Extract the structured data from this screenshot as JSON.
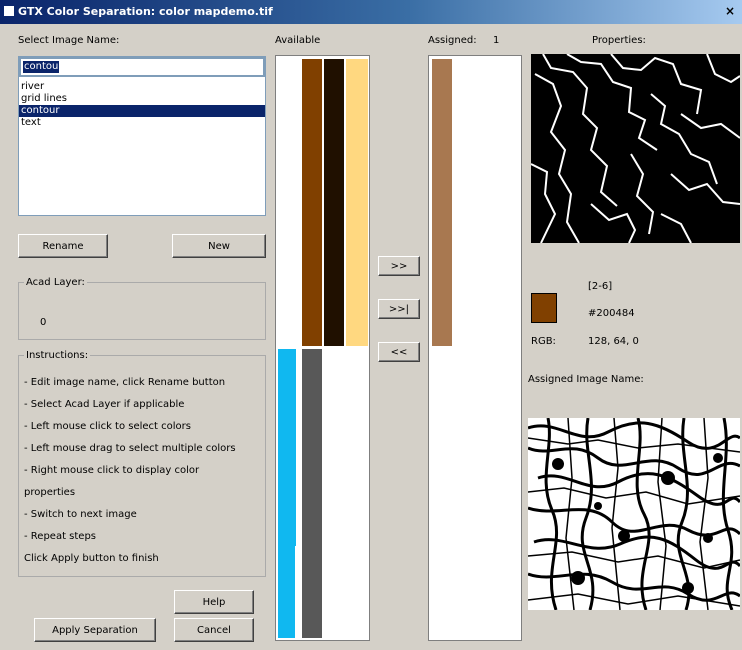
{
  "window": {
    "title": "GTX Color Separation: color mapdemo.tif",
    "close_glyph": "×"
  },
  "left": {
    "select_label": "Select Image Name:",
    "name_value": "contour",
    "list_items": [
      "river",
      "grid lines",
      "contour",
      "text"
    ],
    "selected_index": 2,
    "rename_label": "Rename",
    "new_label": "New",
    "acad_group_label": "Acad Layer:",
    "acad_value": "0",
    "instructions_label": "Instructions:",
    "instructions": [
      "- Edit image name, click Rename button",
      "- Select Acad Layer if applicable",
      "- Left mouse click to select colors",
      "- Left mouse drag to select multiple colors",
      "- Right mouse click to display color",
      "  properties",
      "- Switch to next image",
      "- Repeat steps",
      "Click Apply button to finish"
    ],
    "help_label": "Help",
    "apply_label": "Apply Separation",
    "cancel_label": "Cancel"
  },
  "available": {
    "label": "Available"
  },
  "transfer": {
    "add_label": ">>",
    "add_all_label": ">>|",
    "remove_label": "<<"
  },
  "assigned": {
    "label": "Assigned:",
    "count": "1"
  },
  "properties": {
    "label": "Properties:",
    "index": "[2-6]",
    "hex": "#200484",
    "rgb_label": "RGB:",
    "rgb_value": "128, 64, 0",
    "swatch_color": "#804000",
    "assigned_image_label": "Assigned Image Name:"
  },
  "colors": {
    "brown": "#804000",
    "dark": "#201000",
    "tan": "#ffd880",
    "assigned_brown": "#a87850",
    "blue": "#10b8f0",
    "gray": "#585858",
    "selection": "#0a246a"
  }
}
